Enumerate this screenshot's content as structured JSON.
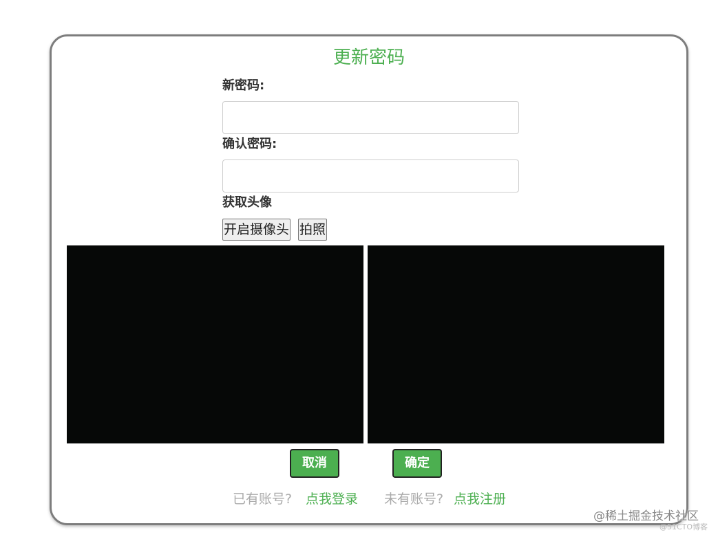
{
  "form": {
    "title": "更新密码",
    "new_password_label": "新密码:",
    "new_password_value": "",
    "confirm_password_label": "确认密码:",
    "confirm_password_value": "",
    "avatar_label": "获取头像",
    "open_camera_label": "开启摄像头",
    "take_photo_label": "拍照",
    "cancel_label": "取消",
    "confirm_label": "确定"
  },
  "footer": {
    "has_account_text": "已有账号?",
    "login_link": "点我登录",
    "no_account_text": "未有账号?",
    "register_link": "点我注册"
  },
  "watermark": {
    "main": "@稀土掘金技术社区",
    "sub": "@51CTO博客"
  },
  "colors": {
    "accent": "#4caf50",
    "border": "#7d7d7d",
    "video_bg": "#060807"
  }
}
